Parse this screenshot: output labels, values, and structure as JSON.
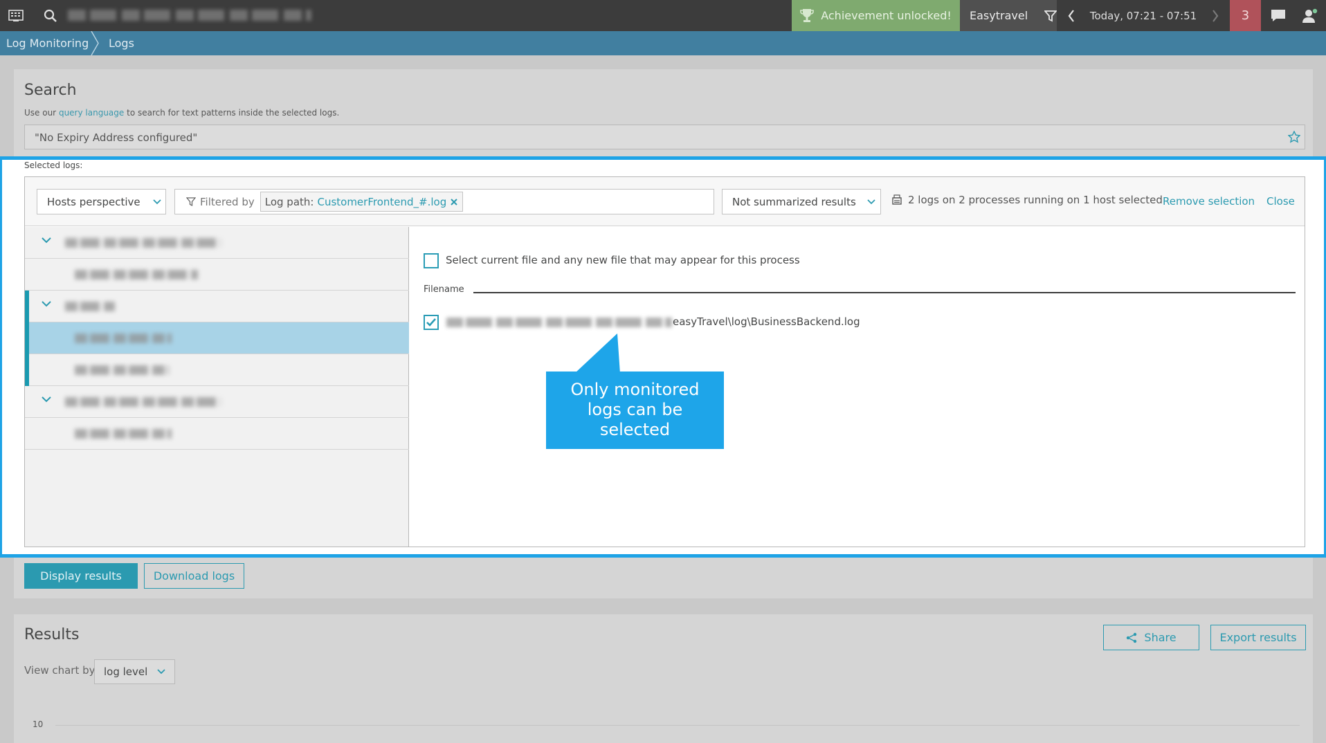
{
  "topbar": {
    "menu_icon": "menu-grid-icon",
    "search_icon": "search-icon",
    "achievement": "Achievement unlocked!",
    "environment": "Easytravel",
    "timeframe": "Today, 07:21 - 07:51",
    "problems_count": "3",
    "colors": {
      "achievement_bg": "#7faa6f",
      "problems_bg": "#b0525a"
    }
  },
  "breadcrumb": {
    "items": [
      "Log Monitoring",
      "Logs"
    ]
  },
  "search": {
    "title": "Search",
    "help_prefix": "Use our",
    "help_link": "query language",
    "help_suffix": "to search for text patterns inside the selected logs.",
    "query": "\"No Expiry Address configured\""
  },
  "selection": {
    "label": "Selected logs:",
    "perspective": "Hosts perspective",
    "filtered_by": "Filtered by",
    "filter_key": "Log path:",
    "filter_value": "CustomerFrontend_#.log",
    "summary_mode": "Not summarized results",
    "info": "2 logs on 2 processes running on 1 host selected",
    "remove_selection": "Remove selection",
    "close": "Close",
    "select_all_label": "Select current file and any new file that may appear for this process",
    "filename_header": "Filename",
    "file_suffix": "easyTravel\\log\\BusinessBackend.log",
    "callout": [
      "Only monitored",
      "logs can be",
      "selected"
    ]
  },
  "actions": {
    "display_results": "Display results",
    "download_logs": "Download logs"
  },
  "results": {
    "title": "Results",
    "share": "Share",
    "export": "Export results",
    "view_chart_by": "View chart by",
    "chart_by_value": "log level",
    "y_tick_top": "10"
  },
  "accent_color": "#1ea3e6"
}
